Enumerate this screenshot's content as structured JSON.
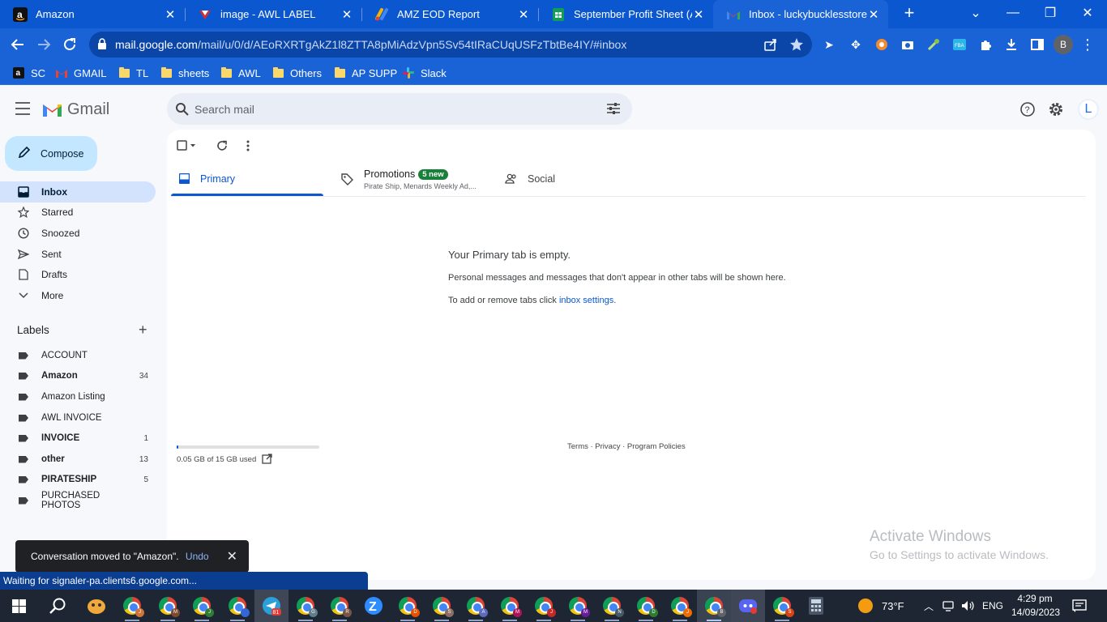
{
  "browser": {
    "tabs": [
      {
        "title": "Amazon",
        "icon": "amazon-icon"
      },
      {
        "title": "image - AWL LABEL",
        "icon": "awl-icon"
      },
      {
        "title": "AMZ EOD Report",
        "icon": "report-icon"
      },
      {
        "title": "September Profit Sheet (AMA",
        "icon": "sheets-icon"
      },
      {
        "title": "Inbox - luckybucklesstore@g",
        "icon": "gmail-icon",
        "active": true
      }
    ],
    "url_host": "mail.google.com",
    "url_path": "/mail/u/0/d/AEoRXRTgAkZ1l8ZTTA8pMiAdzVpn5Sv54tIRaCUqUSFzTbtBe4IY/#inbox",
    "profile_initial": "B",
    "bookmarks": [
      {
        "label": "SC",
        "icon": "amazon-icon"
      },
      {
        "label": "GMAIL",
        "icon": "gmail-icon"
      },
      {
        "label": "TL",
        "icon": "folder-icon"
      },
      {
        "label": "sheets",
        "icon": "folder-icon"
      },
      {
        "label": "AWL",
        "icon": "folder-icon"
      },
      {
        "label": "Others",
        "icon": "folder-icon"
      },
      {
        "label": "AP SUPP",
        "icon": "folder-icon"
      },
      {
        "label": "Slack",
        "icon": "slack-icon"
      }
    ]
  },
  "gmail": {
    "brand": "Gmail",
    "search_placeholder": "Search mail",
    "account_initial": "L",
    "compose_label": "Compose",
    "nav": [
      {
        "label": "Inbox",
        "icon": "inbox-icon",
        "active": true
      },
      {
        "label": "Starred",
        "icon": "star-icon"
      },
      {
        "label": "Snoozed",
        "icon": "clock-icon"
      },
      {
        "label": "Sent",
        "icon": "send-icon"
      },
      {
        "label": "Drafts",
        "icon": "draft-icon"
      },
      {
        "label": "More",
        "icon": "chevron-down-icon"
      }
    ],
    "labels_heading": "Labels",
    "labels": [
      {
        "name": "ACCOUNT",
        "count": "",
        "bold": false
      },
      {
        "name": "Amazon",
        "count": "34",
        "bold": true
      },
      {
        "name": "Amazon Listing",
        "count": "",
        "bold": false
      },
      {
        "name": "AWL INVOICE",
        "count": "",
        "bold": false
      },
      {
        "name": "INVOICE",
        "count": "1",
        "bold": true
      },
      {
        "name": "other",
        "count": "13",
        "bold": true
      },
      {
        "name": "PIRATESHIP",
        "count": "5",
        "bold": true
      },
      {
        "name": "PURCHASED PHOTOS",
        "count": "",
        "bold": false
      }
    ],
    "tabs": {
      "primary": "Primary",
      "promotions": "Promotions",
      "promotions_badge": "5 new",
      "promotions_sub": "Pirate Ship, Menards Weekly Ad,...",
      "social": "Social"
    },
    "empty": {
      "title": "Your Primary tab is empty.",
      "line1": "Personal messages and messages that don't appear in other tabs will be shown here.",
      "line2_prefix": "To add or remove tabs click ",
      "line2_link": "inbox settings",
      "line2_suffix": "."
    },
    "storage": {
      "text": "0.05 GB of 15 GB used",
      "fraction_used": 0.0033
    },
    "footer": "Terms · Privacy · Program Policies",
    "snackbar": {
      "message": "Conversation moved to \"Amazon\".",
      "action": "Undo"
    },
    "status": "Waiting for signaler-pa.clients6.google.com..."
  },
  "watermark": {
    "line1": "Activate Windows",
    "line2": "Go to Settings to activate Windows."
  },
  "taskbar": {
    "weather": "73°F",
    "language": "ENG",
    "time": "4:29 pm",
    "date": "14/09/2023",
    "telegram_badge": "81"
  },
  "colors": {
    "accent": "#0b57d0",
    "chrome_frame": "#1a63d6",
    "compose": "#c2e7ff",
    "active_nav": "#d3e3fd",
    "badge_green": "#188038"
  }
}
